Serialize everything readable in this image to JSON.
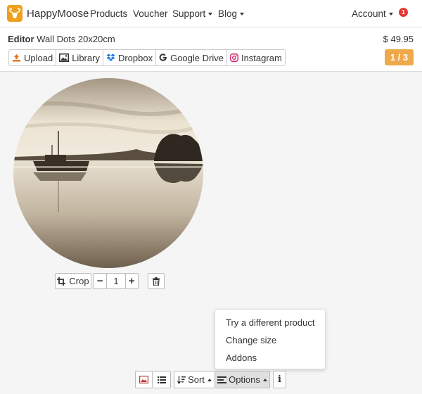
{
  "nav": {
    "brand": "HappyMoose",
    "products": "Products",
    "voucher": "Voucher",
    "support": "Support",
    "blog": "Blog",
    "account": "Account",
    "notification_count": "1"
  },
  "header": {
    "editor_label": "Editor",
    "product_name": "Wall Dots 20x20cm",
    "price": "$ 49.95",
    "sources": {
      "upload": "Upload",
      "library": "Library",
      "dropbox": "Dropbox",
      "google_drive": "Google Drive",
      "instagram": "Instagram"
    },
    "page_indicator": "1 / 3"
  },
  "image_tools": {
    "crop": "Crop",
    "quantity": "1",
    "minus": "−",
    "plus": "+"
  },
  "options_menu": {
    "items": [
      "Try a different product",
      "Change size",
      "Addons"
    ]
  },
  "bottom_toolbar": {
    "sort": "Sort",
    "options": "Options",
    "info": "i"
  }
}
